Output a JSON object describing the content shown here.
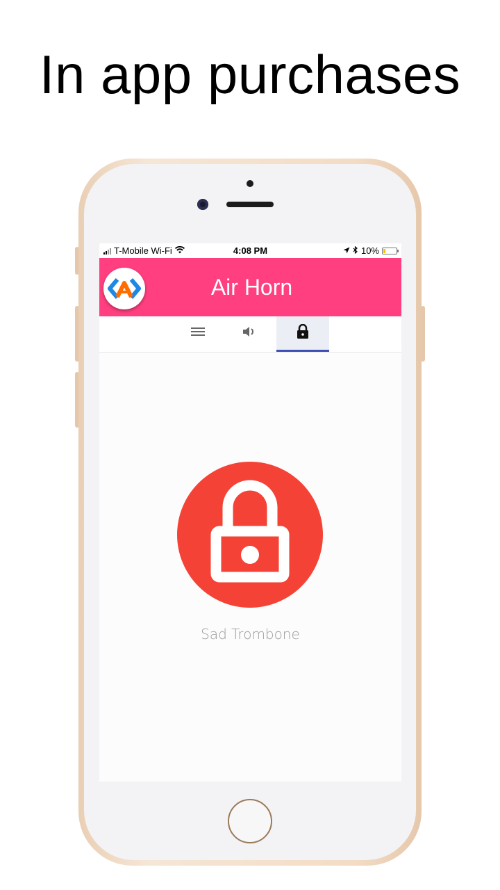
{
  "headline": "In app purchases",
  "status_bar": {
    "carrier": "T-Mobile Wi-Fi",
    "time": "4:08 PM",
    "battery": "10%",
    "battery_level": 0.1
  },
  "app": {
    "title": "Air Horn",
    "accent_color": "#ff3f7f",
    "tab_indicator_color": "#3f51b5"
  },
  "tabs": [
    {
      "icon": "menu-icon",
      "active": false
    },
    {
      "icon": "volume-icon",
      "active": false
    },
    {
      "icon": "lock-icon",
      "active": true
    }
  ],
  "locked_item": {
    "icon": "lock-icon",
    "color": "#f44336",
    "label": "Sad Trombone"
  }
}
